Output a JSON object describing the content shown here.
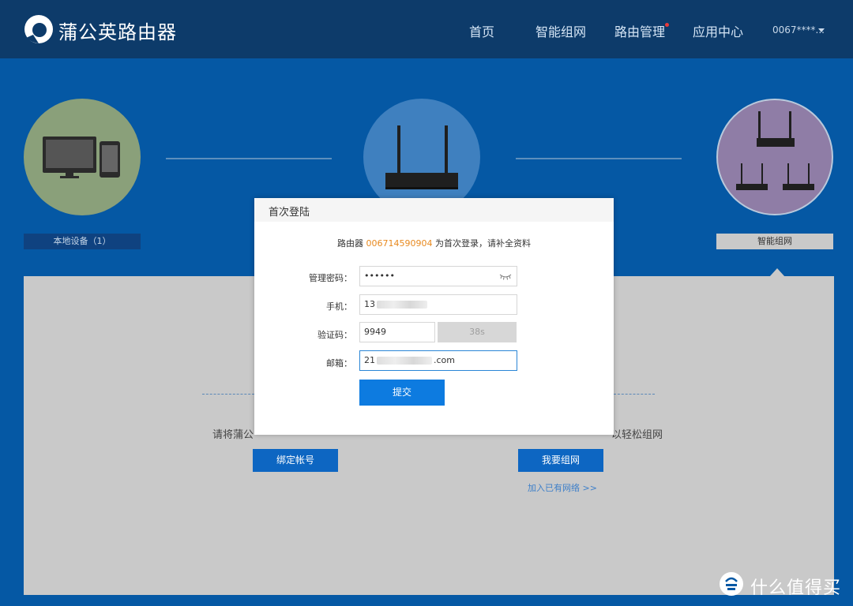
{
  "header": {
    "brand": "蒲公英路由器",
    "nav": [
      "首页",
      "智能组网",
      "路由管理",
      "应用中心"
    ],
    "account": "0067****..."
  },
  "steps": {
    "left_label": "本地设备（1）",
    "right_label": "智能组网"
  },
  "panel": {
    "left_text": "请将蒲公",
    "right_text": "以轻松组网",
    "bind_button": "绑定帐号",
    "network_button": "我要组网",
    "join_link": "加入已有网络 >>"
  },
  "modal": {
    "title": "首次登陆",
    "info_prefix": "路由器 ",
    "router_id": "006714590904",
    "info_suffix": " 为首次登录，请补全资料",
    "password_label": "管理密码：",
    "password_value": "••••••",
    "phone_label": "手机：",
    "phone_value": "13",
    "code_label": "验证码：",
    "code_value": "9949",
    "timer": "38s",
    "email_label": "邮箱：",
    "email_prefix": "21",
    "email_suffix": ".com",
    "submit": "提交"
  },
  "watermark": "什么值得买",
  "colors": {
    "page_bg": "#0558a4",
    "header_bg": "#0d3b6a",
    "primary_button": "#0d7be0",
    "highlight": "#e8891e"
  }
}
